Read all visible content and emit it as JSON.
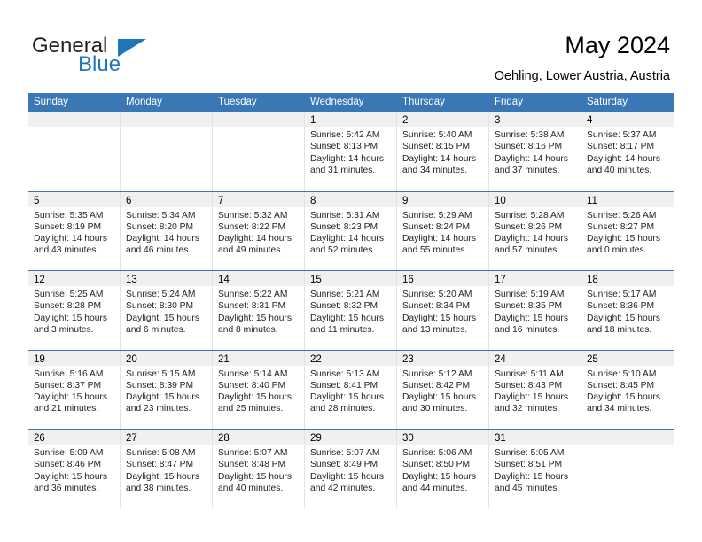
{
  "brand": {
    "name_primary": "General",
    "name_secondary": "Blue"
  },
  "header": {
    "title": "May 2024",
    "subtitle": "Oehling, Lower Austria, Austria"
  },
  "colors": {
    "header_blue": "#3a78b5",
    "brand_blue": "#1f76bc",
    "day_band_gray": "#f0f0f0"
  },
  "weekdays": [
    "Sunday",
    "Monday",
    "Tuesday",
    "Wednesday",
    "Thursday",
    "Friday",
    "Saturday"
  ],
  "weeks": [
    [
      {
        "empty": true
      },
      {
        "empty": true
      },
      {
        "empty": true
      },
      {
        "day": "1",
        "sunrise": "Sunrise: 5:42 AM",
        "sunset": "Sunset: 8:13 PM",
        "daylight1": "Daylight: 14 hours",
        "daylight2": "and 31 minutes."
      },
      {
        "day": "2",
        "sunrise": "Sunrise: 5:40 AM",
        "sunset": "Sunset: 8:15 PM",
        "daylight1": "Daylight: 14 hours",
        "daylight2": "and 34 minutes."
      },
      {
        "day": "3",
        "sunrise": "Sunrise: 5:38 AM",
        "sunset": "Sunset: 8:16 PM",
        "daylight1": "Daylight: 14 hours",
        "daylight2": "and 37 minutes."
      },
      {
        "day": "4",
        "sunrise": "Sunrise: 5:37 AM",
        "sunset": "Sunset: 8:17 PM",
        "daylight1": "Daylight: 14 hours",
        "daylight2": "and 40 minutes."
      }
    ],
    [
      {
        "day": "5",
        "sunrise": "Sunrise: 5:35 AM",
        "sunset": "Sunset: 8:19 PM",
        "daylight1": "Daylight: 14 hours",
        "daylight2": "and 43 minutes."
      },
      {
        "day": "6",
        "sunrise": "Sunrise: 5:34 AM",
        "sunset": "Sunset: 8:20 PM",
        "daylight1": "Daylight: 14 hours",
        "daylight2": "and 46 minutes."
      },
      {
        "day": "7",
        "sunrise": "Sunrise: 5:32 AM",
        "sunset": "Sunset: 8:22 PM",
        "daylight1": "Daylight: 14 hours",
        "daylight2": "and 49 minutes."
      },
      {
        "day": "8",
        "sunrise": "Sunrise: 5:31 AM",
        "sunset": "Sunset: 8:23 PM",
        "daylight1": "Daylight: 14 hours",
        "daylight2": "and 52 minutes."
      },
      {
        "day": "9",
        "sunrise": "Sunrise: 5:29 AM",
        "sunset": "Sunset: 8:24 PM",
        "daylight1": "Daylight: 14 hours",
        "daylight2": "and 55 minutes."
      },
      {
        "day": "10",
        "sunrise": "Sunrise: 5:28 AM",
        "sunset": "Sunset: 8:26 PM",
        "daylight1": "Daylight: 14 hours",
        "daylight2": "and 57 minutes."
      },
      {
        "day": "11",
        "sunrise": "Sunrise: 5:26 AM",
        "sunset": "Sunset: 8:27 PM",
        "daylight1": "Daylight: 15 hours",
        "daylight2": "and 0 minutes."
      }
    ],
    [
      {
        "day": "12",
        "sunrise": "Sunrise: 5:25 AM",
        "sunset": "Sunset: 8:28 PM",
        "daylight1": "Daylight: 15 hours",
        "daylight2": "and 3 minutes."
      },
      {
        "day": "13",
        "sunrise": "Sunrise: 5:24 AM",
        "sunset": "Sunset: 8:30 PM",
        "daylight1": "Daylight: 15 hours",
        "daylight2": "and 6 minutes."
      },
      {
        "day": "14",
        "sunrise": "Sunrise: 5:22 AM",
        "sunset": "Sunset: 8:31 PM",
        "daylight1": "Daylight: 15 hours",
        "daylight2": "and 8 minutes."
      },
      {
        "day": "15",
        "sunrise": "Sunrise: 5:21 AM",
        "sunset": "Sunset: 8:32 PM",
        "daylight1": "Daylight: 15 hours",
        "daylight2": "and 11 minutes."
      },
      {
        "day": "16",
        "sunrise": "Sunrise: 5:20 AM",
        "sunset": "Sunset: 8:34 PM",
        "daylight1": "Daylight: 15 hours",
        "daylight2": "and 13 minutes."
      },
      {
        "day": "17",
        "sunrise": "Sunrise: 5:19 AM",
        "sunset": "Sunset: 8:35 PM",
        "daylight1": "Daylight: 15 hours",
        "daylight2": "and 16 minutes."
      },
      {
        "day": "18",
        "sunrise": "Sunrise: 5:17 AM",
        "sunset": "Sunset: 8:36 PM",
        "daylight1": "Daylight: 15 hours",
        "daylight2": "and 18 minutes."
      }
    ],
    [
      {
        "day": "19",
        "sunrise": "Sunrise: 5:16 AM",
        "sunset": "Sunset: 8:37 PM",
        "daylight1": "Daylight: 15 hours",
        "daylight2": "and 21 minutes."
      },
      {
        "day": "20",
        "sunrise": "Sunrise: 5:15 AM",
        "sunset": "Sunset: 8:39 PM",
        "daylight1": "Daylight: 15 hours",
        "daylight2": "and 23 minutes."
      },
      {
        "day": "21",
        "sunrise": "Sunrise: 5:14 AM",
        "sunset": "Sunset: 8:40 PM",
        "daylight1": "Daylight: 15 hours",
        "daylight2": "and 25 minutes."
      },
      {
        "day": "22",
        "sunrise": "Sunrise: 5:13 AM",
        "sunset": "Sunset: 8:41 PM",
        "daylight1": "Daylight: 15 hours",
        "daylight2": "and 28 minutes."
      },
      {
        "day": "23",
        "sunrise": "Sunrise: 5:12 AM",
        "sunset": "Sunset: 8:42 PM",
        "daylight1": "Daylight: 15 hours",
        "daylight2": "and 30 minutes."
      },
      {
        "day": "24",
        "sunrise": "Sunrise: 5:11 AM",
        "sunset": "Sunset: 8:43 PM",
        "daylight1": "Daylight: 15 hours",
        "daylight2": "and 32 minutes."
      },
      {
        "day": "25",
        "sunrise": "Sunrise: 5:10 AM",
        "sunset": "Sunset: 8:45 PM",
        "daylight1": "Daylight: 15 hours",
        "daylight2": "and 34 minutes."
      }
    ],
    [
      {
        "day": "26",
        "sunrise": "Sunrise: 5:09 AM",
        "sunset": "Sunset: 8:46 PM",
        "daylight1": "Daylight: 15 hours",
        "daylight2": "and 36 minutes."
      },
      {
        "day": "27",
        "sunrise": "Sunrise: 5:08 AM",
        "sunset": "Sunset: 8:47 PM",
        "daylight1": "Daylight: 15 hours",
        "daylight2": "and 38 minutes."
      },
      {
        "day": "28",
        "sunrise": "Sunrise: 5:07 AM",
        "sunset": "Sunset: 8:48 PM",
        "daylight1": "Daylight: 15 hours",
        "daylight2": "and 40 minutes."
      },
      {
        "day": "29",
        "sunrise": "Sunrise: 5:07 AM",
        "sunset": "Sunset: 8:49 PM",
        "daylight1": "Daylight: 15 hours",
        "daylight2": "and 42 minutes."
      },
      {
        "day": "30",
        "sunrise": "Sunrise: 5:06 AM",
        "sunset": "Sunset: 8:50 PM",
        "daylight1": "Daylight: 15 hours",
        "daylight2": "and 44 minutes."
      },
      {
        "day": "31",
        "sunrise": "Sunrise: 5:05 AM",
        "sunset": "Sunset: 8:51 PM",
        "daylight1": "Daylight: 15 hours",
        "daylight2": "and 45 minutes."
      },
      {
        "empty": true
      }
    ]
  ]
}
